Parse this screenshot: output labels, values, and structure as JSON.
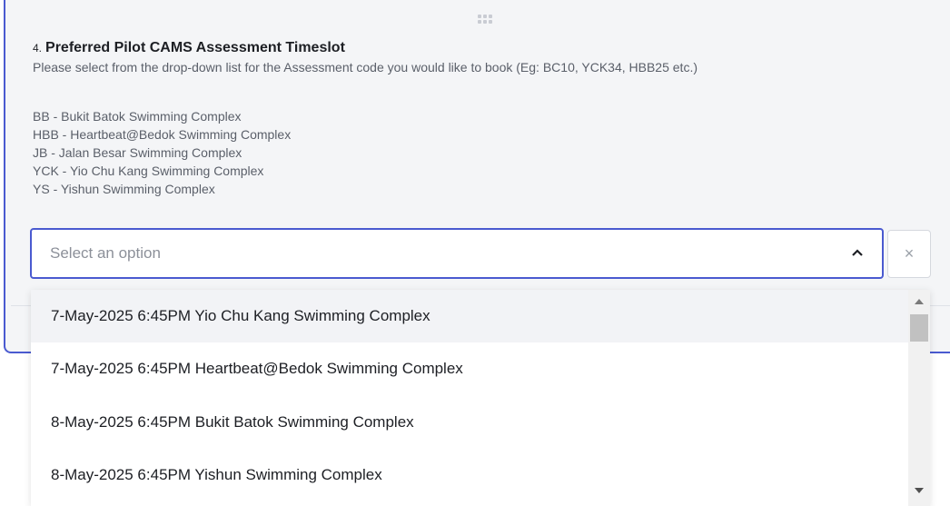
{
  "question": {
    "number": "4.",
    "title": "Preferred Pilot CAMS Assessment Timeslot",
    "description": "Please select from the drop-down list for the Assessment code you would like to book (Eg: BC10, YCK34, HBB25 etc.)",
    "legend": [
      "BB - Bukit Batok Swimming Complex",
      "HBB - Heartbeat@Bedok Swimming Complex",
      "JB - Jalan Besar Swimming Complex",
      "YCK - Yio Chu Kang Swimming Complex",
      "YS - Yishun Swimming Complex"
    ]
  },
  "select": {
    "placeholder": "Select an option",
    "caret_icon": "chevron-up-icon",
    "clear_label": "×",
    "options": [
      "7-May-2025 6:45PM Yio Chu Kang Swimming Complex",
      "7-May-2025 6:45PM Heartbeat@Bedok Swimming Complex",
      "8-May-2025 6:45PM Bukit Batok Swimming Complex",
      "8-May-2025 6:45PM Yishun Swimming Complex"
    ],
    "highlighted_index": 0
  },
  "colors": {
    "accent": "#4a5ad0",
    "card_bg": "#f4f5f7",
    "highlight_bg": "#f2f3f6"
  }
}
